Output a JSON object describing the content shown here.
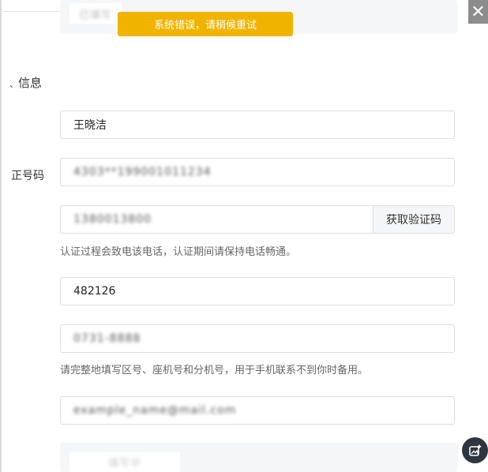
{
  "toast": {
    "message": "系统错误，请稍候重试"
  },
  "close_glyph": "✕",
  "top_box": {
    "text": "已填写"
  },
  "section": {
    "title": "信息",
    "prefix": "、"
  },
  "name_field": {
    "value": "王晓洁"
  },
  "id_label": "正号码",
  "id_field": {
    "value": "4303**199001011234"
  },
  "phone_field": {
    "value": "1380013800"
  },
  "get_code_button": "获取验证码",
  "phone_hint": "认证过程会致电该电话，认证期间请保持电话畅通。",
  "code_field": {
    "value": "482126"
  },
  "landline_field": {
    "value": "0731-8888"
  },
  "landline_hint": "请完整地填写区号、座机号和分机号，用于手机联系不到你时备用。",
  "email_field": {
    "value": "example_name@mail.com"
  },
  "bottom_box": {
    "text": "填写中"
  },
  "icons": {
    "close": "close-icon",
    "float": "image-edit-icon"
  }
}
